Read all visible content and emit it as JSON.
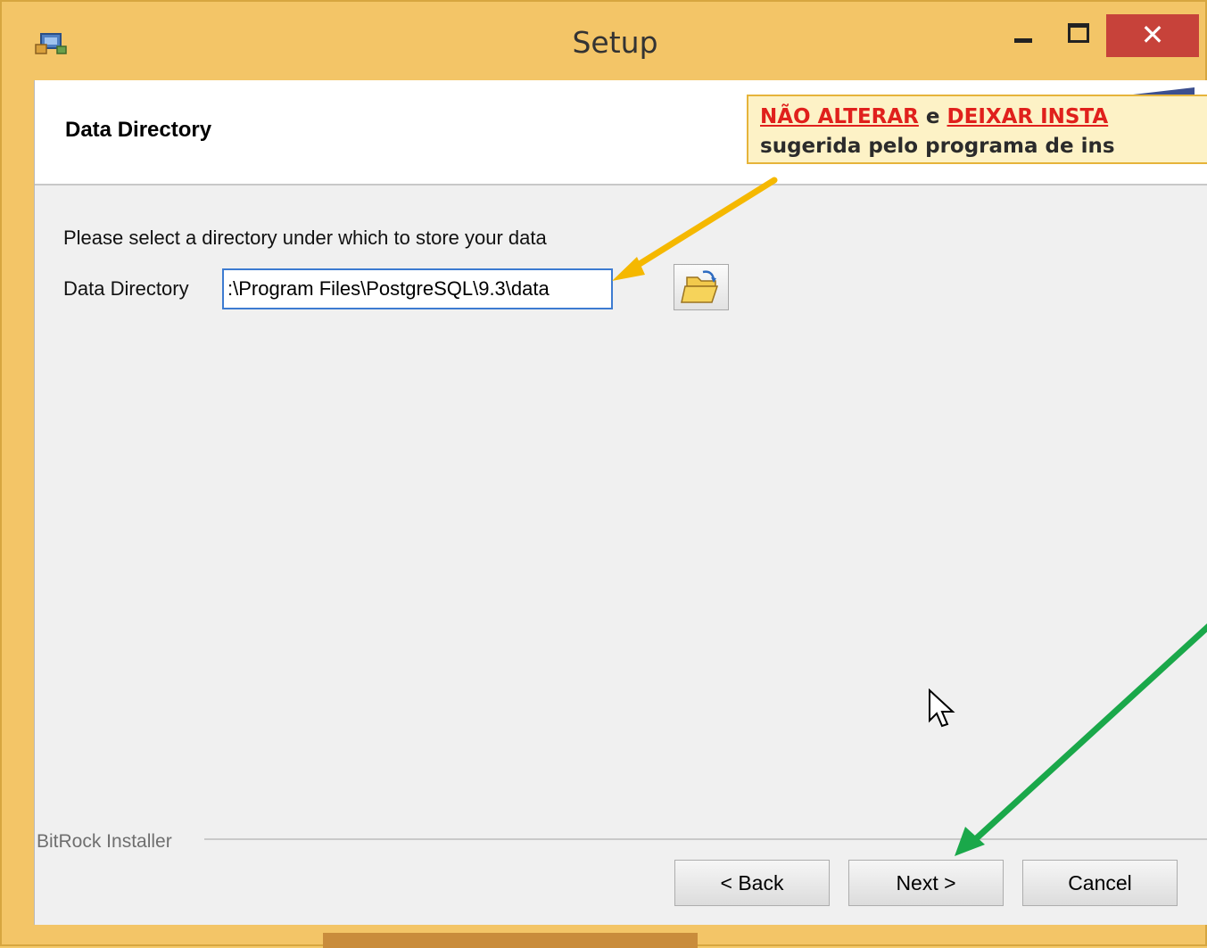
{
  "window": {
    "title": "Setup",
    "minimize_label": "-",
    "maximize_label": "□",
    "close_label": "✕"
  },
  "header": {
    "title": "Data Directory"
  },
  "annotation": {
    "line1_part1": "NÃO ALTERAR",
    "line1_part2": " e ",
    "line1_part3": "DEIXAR INSTA",
    "line2": "sugerida pelo programa de ins"
  },
  "body": {
    "prompt": "Please select a directory under which to store your data",
    "field_label": "Data Directory",
    "field_value": ":\\Program Files\\PostgreSQL\\9.3\\data"
  },
  "footer": {
    "brand": "BitRock Installer",
    "back_label": "< Back",
    "next_label": "Next >",
    "cancel_label": "Cancel"
  },
  "colors": {
    "frame": "#f3c567",
    "close": "#c7423a",
    "arrow_orange": "#f5b800",
    "arrow_green": "#1aa84a",
    "note_red": "#e0201c"
  },
  "icons": [
    "app-icon",
    "folder-open-icon",
    "mouse-cursor-icon"
  ]
}
